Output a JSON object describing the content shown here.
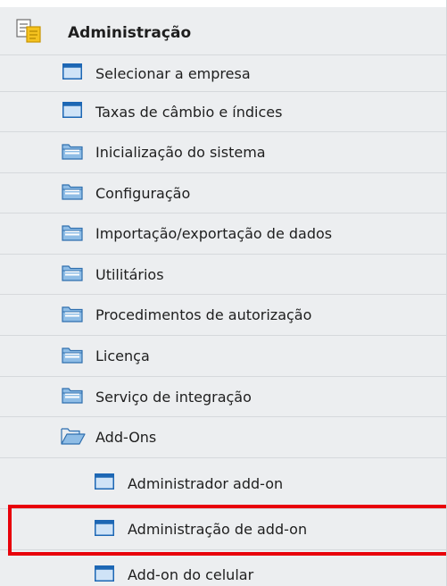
{
  "menu": {
    "title": "Administração",
    "items": [
      {
        "label": "Selecionar a empresa",
        "icon": "window-icon"
      },
      {
        "label": "Taxas de câmbio e índices",
        "icon": "window-icon"
      },
      {
        "label": "Inicialização do sistema",
        "icon": "folder-icon"
      },
      {
        "label": "Configuração",
        "icon": "folder-icon"
      },
      {
        "label": "Importação/exportação de dados",
        "icon": "folder-icon"
      },
      {
        "label": "Utilitários",
        "icon": "folder-icon"
      },
      {
        "label": "Procedimentos de autorização",
        "icon": "folder-icon"
      },
      {
        "label": "Licença",
        "icon": "folder-icon"
      },
      {
        "label": "Serviço de integração",
        "icon": "folder-icon"
      },
      {
        "label": "Add-Ons",
        "icon": "open-folder-icon",
        "expanded": true
      },
      {
        "label": "Administrador add-on",
        "icon": "window-icon"
      },
      {
        "label": "Administração de add-on",
        "icon": "window-icon",
        "highlighted": true
      },
      {
        "label": "Add-on do celular",
        "icon": "window-icon"
      }
    ]
  },
  "colors": {
    "panel_bg": "#eceef0",
    "highlight": "#e8000b",
    "window_icon_blue": "#1d67b4",
    "folder_icon_blue": "#5a91c7"
  }
}
